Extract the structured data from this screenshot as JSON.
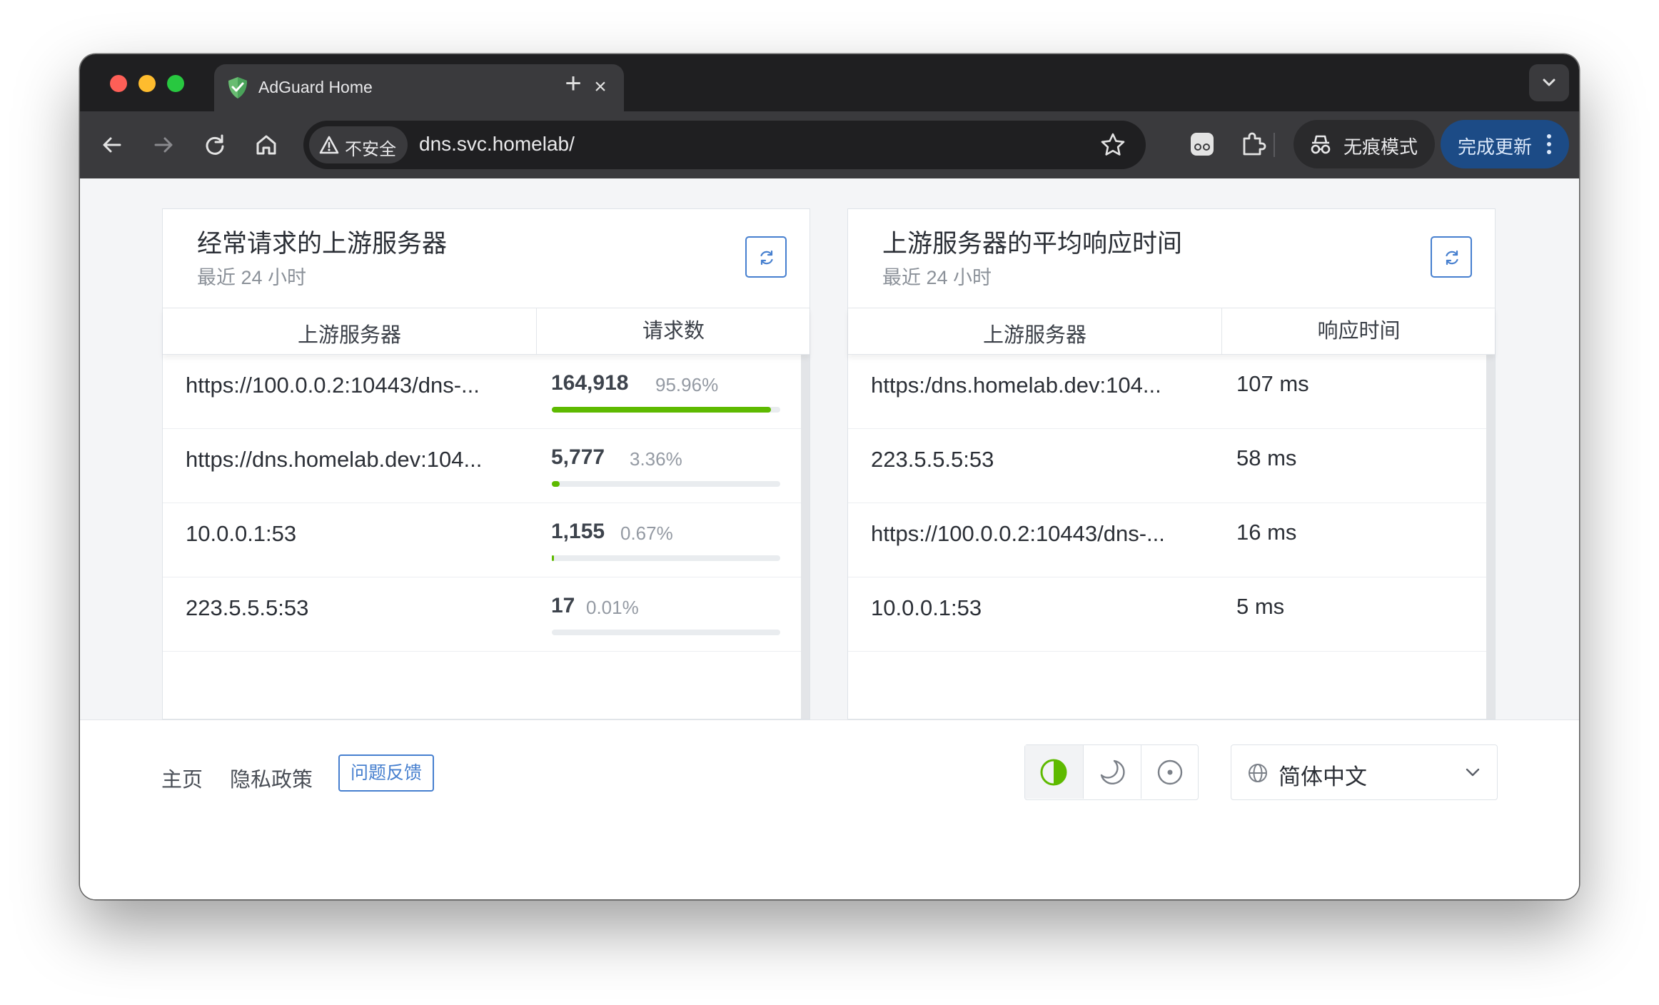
{
  "browser": {
    "tab_title": "AdGuard Home",
    "tab_close_icon": "×",
    "new_tab_icon": "+",
    "security_label": "不安全",
    "url": "dns.svc.homelab/",
    "incognito_label": "无痕模式",
    "update_label": "完成更新"
  },
  "cards": {
    "upstreams": {
      "title": "经常请求的上游服务器",
      "subtitle": "最近 24 小时",
      "col_server": "上游服务器",
      "col_requests": "请求数",
      "rows": [
        {
          "host": "https://100.0.0.2:10443/dns-...",
          "count": "164,918",
          "percent": "95.96%",
          "fraction": 0.9596
        },
        {
          "host": "https://dns.homelab.dev:104...",
          "count": "5,777",
          "percent": "3.36%",
          "fraction": 0.0336
        },
        {
          "host": "10.0.0.1:53",
          "count": "1,155",
          "percent": "0.67%",
          "fraction": 0.0067
        },
        {
          "host": "223.5.5.5:53",
          "count": "17",
          "percent": "0.01%",
          "fraction": 0.0001
        }
      ]
    },
    "response": {
      "title": "上游服务器的平均响应时间",
      "subtitle": "最近 24 小时",
      "col_server": "上游服务器",
      "col_time": "响应时间",
      "rows": [
        {
          "host": "https:/dns.homelab.dev:104...",
          "time": "107 ms"
        },
        {
          "host": "223.5.5.5:53",
          "time": "58 ms"
        },
        {
          "host": "https://100.0.0.2:10443/dns-...",
          "time": "16 ms"
        },
        {
          "host": "10.0.0.1:53",
          "time": "5 ms"
        }
      ]
    }
  },
  "footer": {
    "home": "主页",
    "privacy": "隐私政策",
    "feedback": "问题反馈",
    "theme_active": "auto",
    "language": "简体中文"
  },
  "colors": {
    "accent": "#467fcf",
    "bar_fill": "#5eba00",
    "update_button": "#1c4b86"
  },
  "icons": [
    "shield-favicon-icon",
    "back-icon",
    "forward-icon",
    "reload-icon",
    "home-icon",
    "warning-icon",
    "star-icon",
    "reading-mode-icon",
    "extensions-icon",
    "incognito-icon",
    "more-icon",
    "refresh-icon",
    "contrast-icon",
    "moon-icon",
    "light-icon",
    "globe-icon",
    "chevron-down-icon"
  ]
}
